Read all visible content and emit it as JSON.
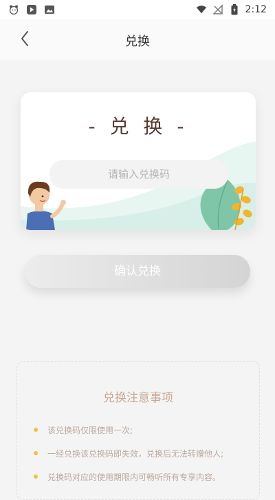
{
  "status_bar": {
    "time": "2:12",
    "left_icons": [
      "dog-icon",
      "play-store-icon",
      "image-icon"
    ],
    "right_icons": [
      "wifi-icon",
      "no-signal-icon",
      "battery-icon"
    ]
  },
  "header": {
    "title": "兑换",
    "back_icon": "chevron-left-icon"
  },
  "card": {
    "title": "- 兑 换 -",
    "input_placeholder": "请输入兑换码",
    "input_value": ""
  },
  "confirm_button": {
    "label": "确认兑换"
  },
  "notes": {
    "title": "兑换注意事项",
    "items": [
      "该兑换码仅限使用一次;",
      "一经兑换该兑换码即失效，兑换后无法转赠他人;",
      "兑换码对应的使用期限内可畅听所有专享内容。"
    ]
  },
  "colors": {
    "title_brown": "#5a3a32",
    "notes_title": "#c9a894",
    "bullet_yellow": "#f2c23c",
    "button_gray": "#d9d9d9"
  }
}
